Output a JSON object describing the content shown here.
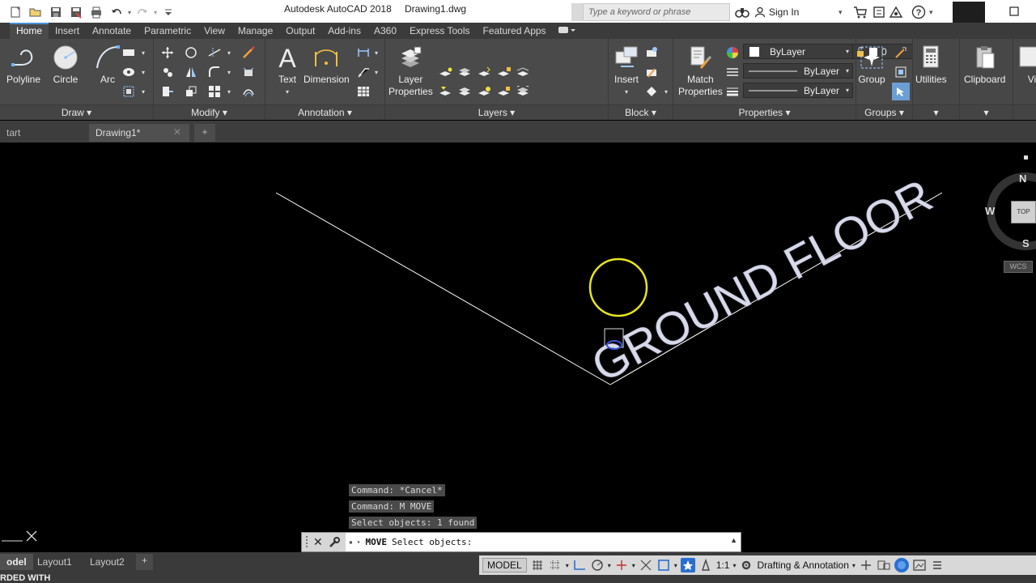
{
  "app": {
    "title": "Autodesk AutoCAD 2018",
    "file": "Drawing1.dwg",
    "search_placeholder": "Type a keyword or phrase",
    "sign_in": "Sign In"
  },
  "ribbon_tabs": [
    "Home",
    "Insert",
    "Annotate",
    "Parametric",
    "View",
    "Manage",
    "Output",
    "Add-ins",
    "A360",
    "Express Tools",
    "Featured Apps"
  ],
  "panels": {
    "draw": {
      "title": "Draw",
      "polyline": "Polyline",
      "circle": "Circle",
      "arc": "Arc"
    },
    "modify": {
      "title": "Modify"
    },
    "annotation": {
      "title": "Annotation",
      "text": "Text",
      "dimension": "Dimension"
    },
    "layers": {
      "title": "Layers",
      "layer_properties_1": "Layer",
      "layer_properties_2": "Properties",
      "current_layer": "0"
    },
    "block": {
      "title": "Block",
      "insert": "Insert"
    },
    "properties": {
      "title": "Properties",
      "match_1": "Match",
      "match_2": "Properties",
      "color": "ByLayer",
      "linetype": "ByLayer",
      "lineweight": "ByLayer"
    },
    "groups": {
      "title": "Groups",
      "group": "Group"
    },
    "utilities": {
      "label": "Utilities"
    },
    "clipboard": {
      "label": "Clipboard"
    },
    "view": {
      "label": "Vi"
    }
  },
  "doc_tabs": {
    "start": "tart",
    "drawing": "Drawing1*"
  },
  "drawing": {
    "text": "GROUND FLOOR",
    "line_color": "#ffffff",
    "circle_color": "#e6e61e"
  },
  "viewcube": {
    "n": "N",
    "s": "S",
    "w": "W",
    "top": "TOP",
    "wcs": "WCS"
  },
  "command": {
    "history": [
      "Command: *Cancel*",
      "Command: M MOVE",
      "Select objects: 1 found"
    ],
    "prompt_cmd": "MOVE",
    "prompt_text": "Select objects:"
  },
  "layout_tabs": [
    "odel",
    "Layout1",
    "Layout2"
  ],
  "status": {
    "model": "MODEL",
    "scale": "1:1",
    "workspace": "Drafting & Annotation",
    "bottom_text": "RDED WITH"
  }
}
